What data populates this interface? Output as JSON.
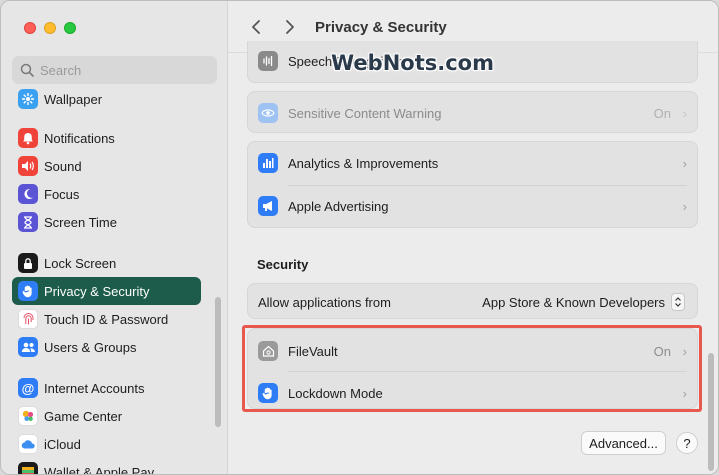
{
  "window": {
    "title": "Privacy & Security"
  },
  "search": {
    "placeholder": "Search"
  },
  "watermark": "WebNots.com",
  "sidebar": {
    "items": [
      {
        "label": "Wallpaper",
        "icon": "wallpaper-icon",
        "color": "#3aa0f0"
      },
      {
        "label": "Notifications",
        "icon": "bell-icon",
        "color": "#f0443a"
      },
      {
        "label": "Sound",
        "icon": "speaker-icon",
        "color": "#f0443a"
      },
      {
        "label": "Focus",
        "icon": "moon-icon",
        "color": "#5b55d6"
      },
      {
        "label": "Screen Time",
        "icon": "hourglass-icon",
        "color": "#5b55d6"
      },
      {
        "label": "Lock Screen",
        "icon": "lock-icon",
        "color": "#1a1a1a"
      },
      {
        "label": "Privacy & Security",
        "icon": "hand-icon",
        "color": "#2f7df6"
      },
      {
        "label": "Touch ID & Password",
        "icon": "fingerprint-icon",
        "color": "#ffffff"
      },
      {
        "label": "Users & Groups",
        "icon": "users-icon",
        "color": "#2f7df6"
      },
      {
        "label": "Internet Accounts",
        "icon": "at-icon",
        "color": "#2f7df6"
      },
      {
        "label": "Game Center",
        "icon": "game-center-icon",
        "color": "#ffffff"
      },
      {
        "label": "iCloud",
        "icon": "cloud-icon",
        "color": "#ffffff"
      },
      {
        "label": "Wallet & Apple Pay",
        "icon": "wallet-icon",
        "color": "#1a1a1a"
      }
    ]
  },
  "main": {
    "privacy_rows": [
      {
        "label": "Speech Recognition",
        "icon": "waveform-icon"
      },
      {
        "label": "Sensitive Content Warning",
        "value": "On",
        "icon": "eye-warning-icon"
      },
      {
        "label": "Analytics & Improvements",
        "icon": "chart-icon"
      },
      {
        "label": "Apple Advertising",
        "icon": "megaphone-icon"
      }
    ],
    "security_title": "Security",
    "allow_apps": {
      "label": "Allow applications from",
      "value": "App Store & Known Developers"
    },
    "filevault": {
      "label": "FileVault",
      "value": "On"
    },
    "lockdown": {
      "label": "Lockdown Mode"
    },
    "advanced_label": "Advanced...",
    "help_label": "?"
  }
}
